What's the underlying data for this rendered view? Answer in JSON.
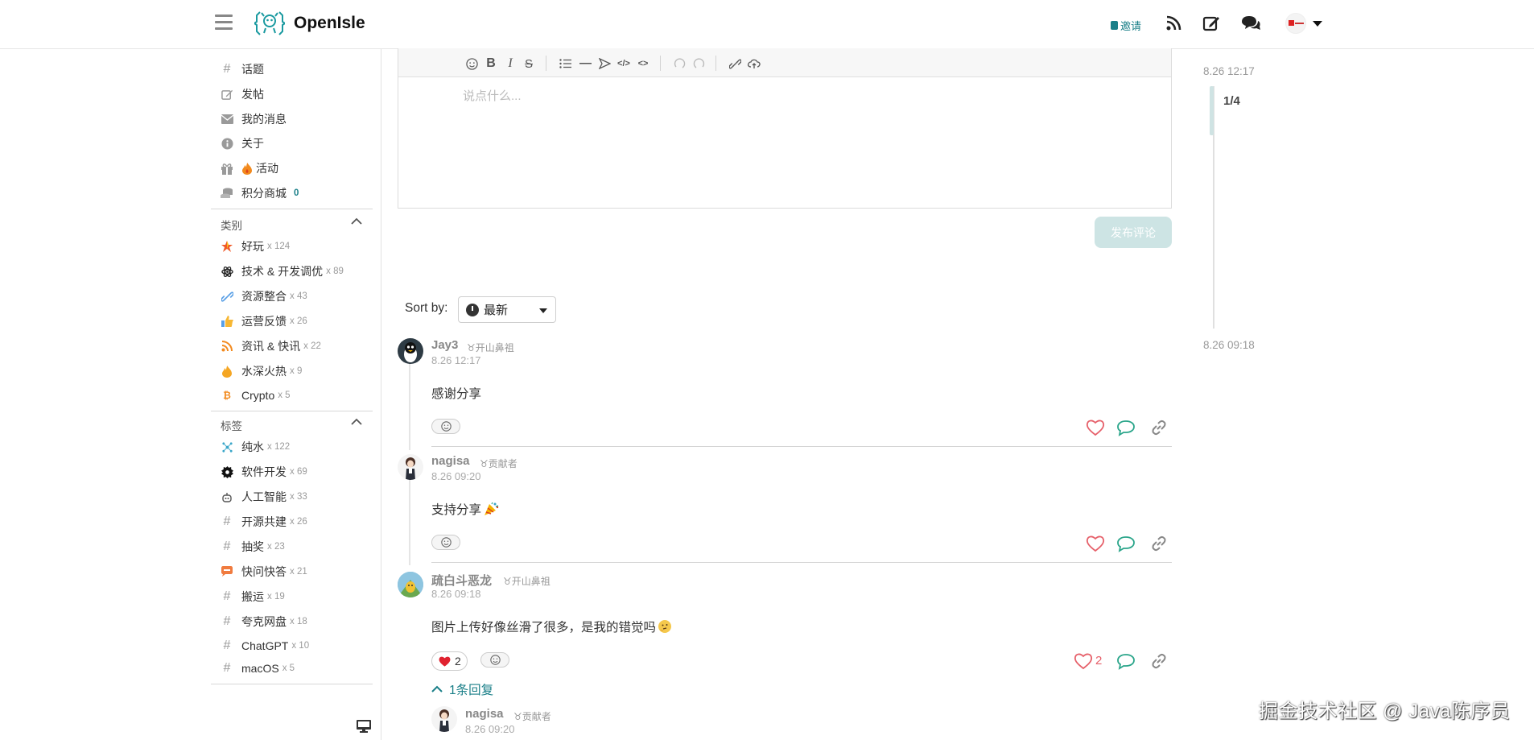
{
  "app": {
    "name": "OpenIsle"
  },
  "header": {
    "invite_label": "邀请",
    "icons": [
      "menu-icon",
      "rss-icon",
      "edit-icon",
      "chat-icon",
      "chevron-down-icon"
    ]
  },
  "sidebar": {
    "nav": [
      {
        "label": "话题",
        "icon": "hash-icon"
      },
      {
        "label": "发帖",
        "icon": "edit-icon"
      },
      {
        "label": "我的消息",
        "icon": "mail-icon"
      },
      {
        "label": "关于",
        "icon": "info-icon"
      },
      {
        "label": "活动",
        "icon": "gift-icon"
      },
      {
        "label": "积分商城",
        "icon": "coins-icon",
        "count": "0"
      }
    ],
    "categories_title": "类别",
    "categories": [
      {
        "label": "好玩",
        "count": "x 124"
      },
      {
        "label": "技术 & 开发调优",
        "count": "x 89"
      },
      {
        "label": "资源整合",
        "count": "x 43"
      },
      {
        "label": "运营反馈",
        "count": "x 26"
      },
      {
        "label": "资讯 & 快讯",
        "count": "x 22"
      },
      {
        "label": "水深火热",
        "count": "x 9"
      },
      {
        "label": "Crypto",
        "count": "x 5"
      }
    ],
    "tags_title": "标签",
    "tags": [
      {
        "label": "纯水",
        "count": "x 122"
      },
      {
        "label": "软件开发",
        "count": "x 69"
      },
      {
        "label": "人工智能",
        "count": "x 33"
      },
      {
        "label": "开源共建",
        "count": "x 26"
      },
      {
        "label": "抽奖",
        "count": "x 23"
      },
      {
        "label": "快问快答",
        "count": "x 21"
      },
      {
        "label": "搬运",
        "count": "x 19"
      },
      {
        "label": "夸克网盘",
        "count": "x 18"
      },
      {
        "label": "ChatGPT",
        "count": "x 10"
      },
      {
        "label": "macOS",
        "count": "x 5"
      }
    ]
  },
  "editor": {
    "placeholder": "说点什么...",
    "publish_label": "发布评论"
  },
  "sort": {
    "label": "Sort by:",
    "value": "最新"
  },
  "comments": [
    {
      "name": "Jay3",
      "badge": "开山鼻祖",
      "time": "8.26 12:17",
      "text": "感谢分享"
    },
    {
      "name": "nagisa",
      "badge": "贡献者",
      "time": "8.26 09:20",
      "text": "支持分享"
    },
    {
      "name": "疏白斗恶龙",
      "badge": "开山鼻祖",
      "time": "8.26 09:18",
      "text": "图片上传好像丝滑了很多，是我的错觉吗",
      "reaction_count": "2",
      "like_count": "2",
      "replies_label": "1条回复"
    }
  ],
  "reply": {
    "name": "nagisa",
    "badge": "贡献者",
    "time": "8.26 09:20"
  },
  "timeline": {
    "start": "8.26 12:17",
    "progress": "1/4",
    "end": "8.26 09:18"
  },
  "watermark": "掘金技术社区 @ Java陈序员",
  "colors": {
    "accent": "#1a7f88",
    "like": "#e6606a",
    "publish_disabled": "#cde4e4"
  }
}
